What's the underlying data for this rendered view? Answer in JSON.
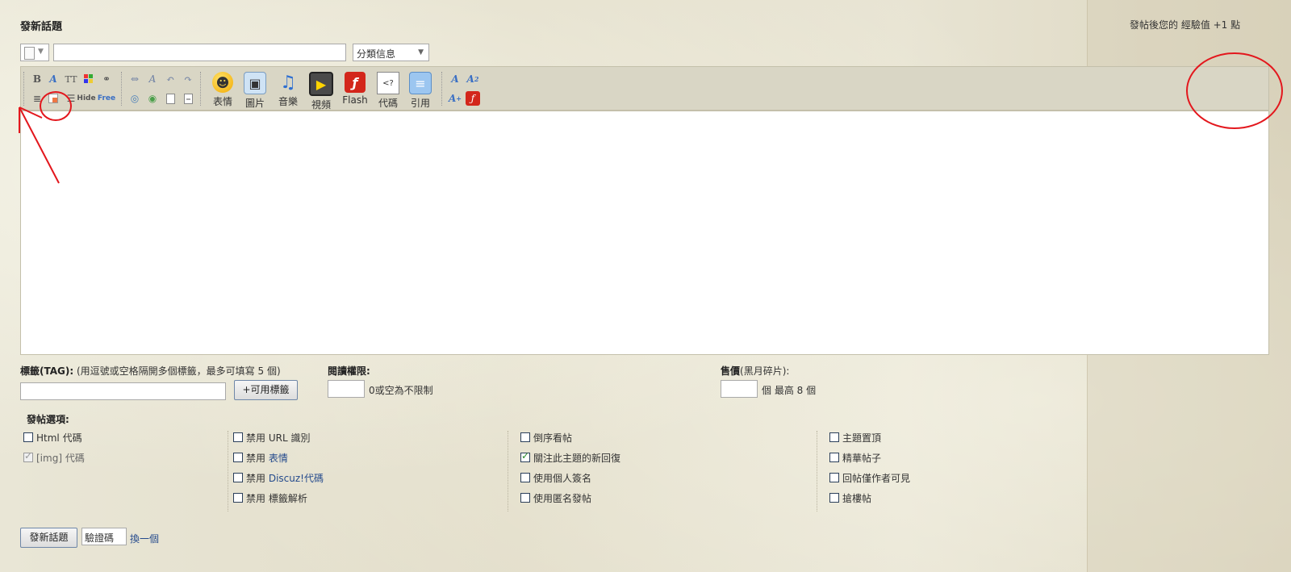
{
  "header": {
    "title": "發新話題",
    "experience_notice": "發帖後您的 經驗值 +1 點"
  },
  "subject": {
    "icon_select": "post-icon-select",
    "value": "",
    "category_value": "分類信息"
  },
  "toolbar": {
    "small_buttons_row1": [
      "B",
      "A",
      "TT",
      "color",
      "link",
      "unlink",
      "Ax",
      "undo",
      "redo"
    ],
    "small_buttons_row2": [
      "align",
      "hide-post",
      "list",
      "Hide",
      "Free",
      "insert-1",
      "insert-2",
      "page",
      "page-break"
    ],
    "big_buttons": [
      "表情",
      "圖片",
      "音樂",
      "視頻",
      "Flash",
      "代碼",
      "引用"
    ],
    "font_buttons": [
      "A",
      "A₂",
      "A⁺",
      "flash"
    ]
  },
  "editor": {
    "content": ""
  },
  "tag": {
    "label": "標籤(TAG):",
    "hint": "(用逗號或空格隔開多個標籤，最多可填寫 5 個)",
    "value": "",
    "button": "+可用標籤"
  },
  "read_perm": {
    "label": "閱讀權限:",
    "value": "",
    "hint": "0或空為不限制"
  },
  "price": {
    "label": "售價",
    "unit": "(黑月碎片):",
    "value": "",
    "hint": "個 最高 8 個"
  },
  "options": {
    "label": "發帖選項:",
    "col1": [
      {
        "text": "Html 代碼",
        "checked": false,
        "disabled": false
      },
      {
        "text": "[img] 代碼",
        "checked": true,
        "disabled": true
      }
    ],
    "col2": [
      {
        "prefix": "禁用",
        "text": "URL 識別",
        "link": false
      },
      {
        "prefix": "禁用",
        "text": "表情",
        "link": true
      },
      {
        "prefix": "禁用",
        "text": "Discuz!代碼",
        "link": true
      },
      {
        "prefix": "禁用",
        "text": "標籤解析",
        "link": false
      }
    ],
    "col3": [
      {
        "text": "倒序看帖",
        "checked": false
      },
      {
        "text": "關注此主題的新回復",
        "checked": true
      },
      {
        "text": "使用個人簽名",
        "checked": false
      },
      {
        "text": "使用匿名發帖",
        "checked": false
      }
    ],
    "col4": [
      {
        "text": "主題置頂",
        "checked": false
      },
      {
        "text": "精華帖子",
        "checked": false
      },
      {
        "text": "回帖僅作者可見",
        "checked": false
      },
      {
        "text": "搶樓帖",
        "checked": false
      }
    ]
  },
  "submit": {
    "button": "發新話題",
    "captcha_value": "驗證碼",
    "refresh": "換一個"
  },
  "colors": {
    "annotation": "#e3171d",
    "link": "#244a8c"
  }
}
